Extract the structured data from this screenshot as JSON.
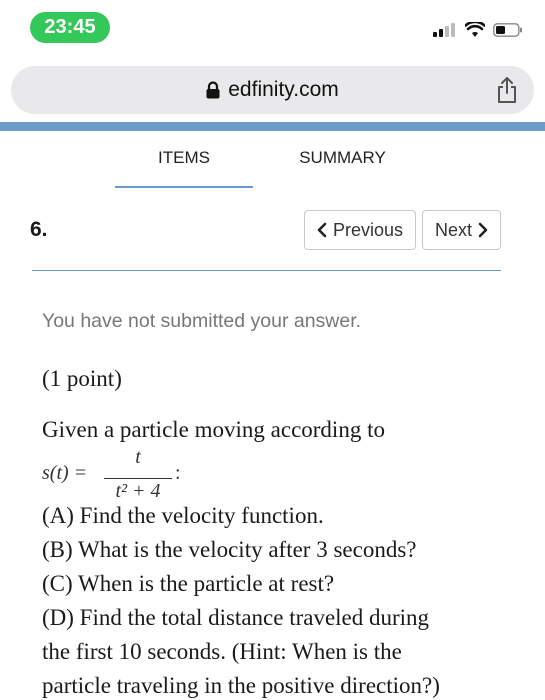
{
  "status": {
    "time": "23:45"
  },
  "browser": {
    "url": "edfinity.com"
  },
  "tabs": [
    {
      "label": "ITEMS"
    },
    {
      "label": "SUMMARY"
    }
  ],
  "question": {
    "number": "6.",
    "prev_label": "Previous",
    "next_label": "Next",
    "notice": "You have not submitted your answer.",
    "points": "(1 point)",
    "intro": "Given a particle moving according to",
    "formula": {
      "lhs": "s(t) =",
      "numerator": "t",
      "denominator": "t² + 4",
      "trail": ":"
    },
    "parts": [
      "(A) Find the velocity function.",
      "(B) What is the velocity after 3 seconds?",
      "(C) When is the particle at rest?",
      "(D) Find the total distance traveled during",
      "the first 10 seconds. (Hint: When is the",
      "particle traveling in the positive direction?)"
    ]
  },
  "colors": {
    "accent": "#6b9bc9",
    "time_pill": "#34c759",
    "url_bar": "#e9e9eb"
  },
  "icons": [
    "signal-icon",
    "wifi-icon",
    "battery-icon",
    "lock-icon",
    "share-icon",
    "chevron-left-icon",
    "chevron-right-icon"
  ]
}
